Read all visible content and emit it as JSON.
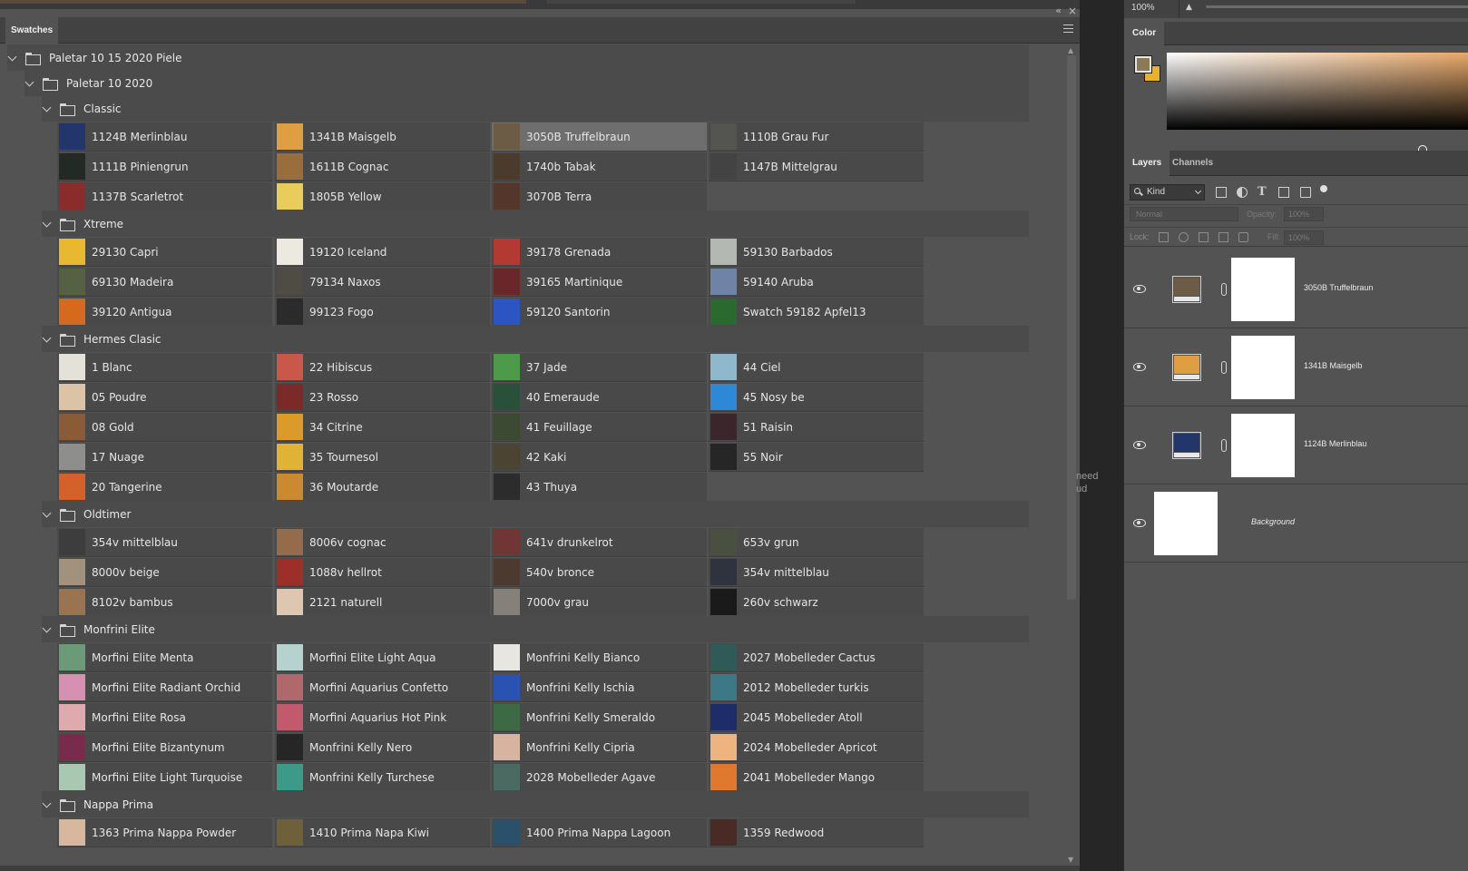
{
  "swatches_panel": {
    "tab_label": "Swatches",
    "root_group": "Paletar 10 15 2020 Piele",
    "sub_group": "Paletar 10 2020",
    "groups": [
      {
        "name": "Classic",
        "swatches": [
          {
            "label": "1124B Merlinblau",
            "color": "#22366b"
          },
          {
            "label": "1341B Maisgelb",
            "color": "#e09e42"
          },
          {
            "label": "3050B Truffelbraun",
            "color": "#6c5b45",
            "selected": true
          },
          {
            "label": "1110B Grau Fur",
            "color": "#545450"
          },
          {
            "label": "1111B Piniengrun",
            "color": "#232925"
          },
          {
            "label": "1611B Cognac",
            "color": "#9a6e3c"
          },
          {
            "label": "1740b Tabak",
            "color": "#4a3b2c"
          },
          {
            "label": "1147B Mittelgrau",
            "color": "#434343"
          },
          {
            "label": "1137B Scarletrot",
            "color": "#8a2c2a"
          },
          {
            "label": "1805B Yellow",
            "color": "#e8cd5a"
          },
          {
            "label": "3070B Terra",
            "color": "#55362a"
          }
        ]
      },
      {
        "name": "Xtreme",
        "swatches": [
          {
            "label": "29130 Capri",
            "color": "#e8b92e"
          },
          {
            "label": "19120 Iceland",
            "color": "#ece9e0"
          },
          {
            "label": "39178 Grenada",
            "color": "#b23a33"
          },
          {
            "label": "59130 Barbados",
            "color": "#b3b8b2"
          },
          {
            "label": "69130 Madeira",
            "color": "#566042"
          },
          {
            "label": "79134 Naxos",
            "color": "#4e4c45"
          },
          {
            "label": "39165 Martinique",
            "color": "#6a2729"
          },
          {
            "label": "59140 Aruba",
            "color": "#6e83a6"
          },
          {
            "label": "39120 Antigua",
            "color": "#d56a1f"
          },
          {
            "label": "99123 Fogo",
            "color": "#2b2b2b"
          },
          {
            "label": "59120 Santorin",
            "color": "#2a55c2"
          },
          {
            "label": "Swatch 59182 Apfel13",
            "color": "#2a6a2f"
          }
        ]
      },
      {
        "name": "Hermes Clasic",
        "swatches": [
          {
            "label": "1 Blanc",
            "color": "#e4e0da"
          },
          {
            "label": "22 Hibiscus",
            "color": "#c9574a"
          },
          {
            "label": "37 Jade",
            "color": "#4d9a4a"
          },
          {
            "label": "44 Ciel",
            "color": "#8fb8cc"
          },
          {
            "label": "05 Poudre",
            "color": "#dcc3a4"
          },
          {
            "label": "23 Rosso",
            "color": "#7b2a27"
          },
          {
            "label": "40 Emeraude",
            "color": "#28503a"
          },
          {
            "label": "45 Nosy be",
            "color": "#2e88d8"
          },
          {
            "label": "08 Gold",
            "color": "#8b5a36"
          },
          {
            "label": "34 Citrine",
            "color": "#dc9a28"
          },
          {
            "label": "41 Feuillage",
            "color": "#3c4a34"
          },
          {
            "label": "51 Raisin",
            "color": "#3a262b"
          },
          {
            "label": "17 Nuage",
            "color": "#8e8e8c"
          },
          {
            "label": "35 Tournesol",
            "color": "#e0b334"
          },
          {
            "label": "42 Kaki",
            "color": "#4c4432"
          },
          {
            "label": "55 Noir",
            "color": "#262626"
          },
          {
            "label": "20 Tangerine",
            "color": "#d4612a"
          },
          {
            "label": "36 Moutarde",
            "color": "#cc8a30"
          },
          {
            "label": "43 Thuya",
            "color": "#2c2c2c"
          }
        ]
      },
      {
        "name": "Oldtimer",
        "swatches": [
          {
            "label": "354v mittelblau",
            "color": "#3d3d3d"
          },
          {
            "label": "8006v cognac",
            "color": "#946c4c"
          },
          {
            "label": "641v drunkelrot",
            "color": "#703634"
          },
          {
            "label": "653v grun",
            "color": "#4a5040"
          },
          {
            "label": "8000v beige",
            "color": "#a0927c"
          },
          {
            "label": "1088v hellrot",
            "color": "#9c3028"
          },
          {
            "label": "540v bronce",
            "color": "#4c3a30"
          },
          {
            "label": "354v mittelblau",
            "color": "#2f3340"
          },
          {
            "label": "8102v bambus",
            "color": "#9a7450"
          },
          {
            "label": "2121 naturell",
            "color": "#dfc6ae"
          },
          {
            "label": "7000v grau",
            "color": "#85807a"
          },
          {
            "label": "260v schwarz",
            "color": "#1a1a1a"
          }
        ]
      },
      {
        "name": "Monfrini Elite",
        "swatches": [
          {
            "label": "Morfini Elite Menta",
            "color": "#6a9a78"
          },
          {
            "label": "Morfini Elite Light Aqua",
            "color": "#b6d2cf"
          },
          {
            "label": "Monfrini Kelly Bianco",
            "color": "#e8e6e0"
          },
          {
            "label": "2027 Mobelleder Cactus",
            "color": "#2f5a58"
          },
          {
            "label": "Morfini Elite Radiant Orchid",
            "color": "#d690b0"
          },
          {
            "label": "Morfini Aquarius Confetto",
            "color": "#b0686c"
          },
          {
            "label": "Monfrini Kelly Ischia",
            "color": "#2a52b2"
          },
          {
            "label": "2012 Mobelleder turkis",
            "color": "#3c7886"
          },
          {
            "label": "Morfini Elite Rosa",
            "color": "#dfaaad"
          },
          {
            "label": "Morfini Aquarius Hot Pink",
            "color": "#c05a6c"
          },
          {
            "label": "Monfrini Kelly Smeraldo",
            "color": "#3c6a44"
          },
          {
            "label": "2045 Mobelleder Atoll",
            "color": "#1f2c6a"
          },
          {
            "label": "Morfini Elite Bizantynum",
            "color": "#7a2a4a"
          },
          {
            "label": "Monfrini Kelly Nero",
            "color": "#262626"
          },
          {
            "label": "Monfrini Kelly Cipria",
            "color": "#d6b4a0"
          },
          {
            "label": "2024 Mobelleder Apricot",
            "color": "#eeb480"
          },
          {
            "label": "Morfini Elite Light Turquoise",
            "color": "#a8c8b2"
          },
          {
            "label": "Monfrini Kelly Turchese",
            "color": "#3c9a88"
          },
          {
            "label": "2028 Mobelleder Agave",
            "color": "#4a6a62"
          },
          {
            "label": "2041 Mobelleder Mango",
            "color": "#e0782e"
          }
        ]
      },
      {
        "name": "Nappa Prima",
        "swatches": [
          {
            "label": "1363 Prima Nappa Powder",
            "color": "#d8b89c"
          },
          {
            "label": "1410 Prima Napa Kiwi",
            "color": "#6e6038"
          },
          {
            "label": "1400 Prima Nappa Lagoon",
            "color": "#2a506a"
          },
          {
            "label": "1359 Redwood",
            "color": "#4a2a24"
          }
        ]
      }
    ]
  },
  "gap_text": "need\nud",
  "right_panel": {
    "zoom": "100%",
    "color_tab": "Color",
    "foreground_color": "#8a7a55",
    "background_color": "#e9b12e",
    "layers_tab": "Layers",
    "channels_tab": "Channels",
    "filter_kind": "Kind",
    "blend_mode": "Normal",
    "opacity_label": "Opacity:",
    "opacity_value": "100%",
    "lock_label": "Lock:",
    "fill_label": "Fill:",
    "fill_value": "100%",
    "layers": [
      {
        "name": "3050B Truffelbraun",
        "color": "#6c5b45"
      },
      {
        "name": "1341B Maisgelb",
        "color": "#e09e42"
      },
      {
        "name": "1124B Merlinblau",
        "color": "#22366b"
      }
    ],
    "background_layer": "Background"
  }
}
